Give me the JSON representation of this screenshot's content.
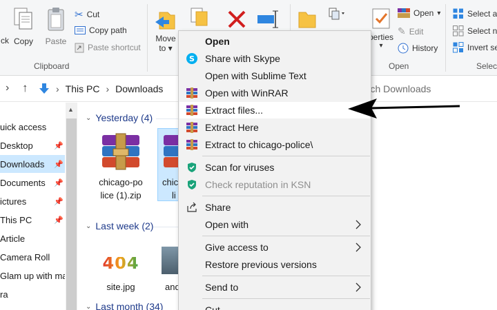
{
  "ribbon": {
    "clipboard": {
      "back_partial": "ck",
      "copy": "Copy",
      "paste": "Paste",
      "cut": "Cut",
      "copy_path": "Copy path",
      "paste_shortcut": "Paste shortcut",
      "group_label": "Clipboard"
    },
    "organize": {
      "move_to_line1": "Move",
      "move_to_line2": "to"
    },
    "open": {
      "properties_partial": "perties",
      "open": "Open",
      "edit": "Edit",
      "history": "History",
      "group_label": "Open"
    },
    "select": {
      "select_all": "Select al",
      "select_none": "Select no",
      "invert_selection": "Invert se",
      "group_label": "Selec"
    }
  },
  "address": {
    "this_pc": "This PC",
    "downloads": "Downloads",
    "search_placeholder": "arch Downloads"
  },
  "nav": {
    "items": [
      {
        "label": "uick access",
        "pinned": false,
        "selected": false
      },
      {
        "label": "Desktop",
        "pinned": true,
        "selected": false
      },
      {
        "label": "Downloads",
        "pinned": true,
        "selected": true
      },
      {
        "label": "Documents",
        "pinned": true,
        "selected": false
      },
      {
        "label": "ictures",
        "pinned": true,
        "selected": false
      },
      {
        "label": "This PC",
        "pinned": true,
        "selected": false
      },
      {
        "label": "Article",
        "pinned": false,
        "selected": false
      },
      {
        "label": "Camera Roll",
        "pinned": false,
        "selected": false
      },
      {
        "label": "Glam up with ma",
        "pinned": false,
        "selected": false
      },
      {
        "label": "ra",
        "pinned": false,
        "selected": false
      }
    ]
  },
  "files": {
    "groups": [
      {
        "label": "Yesterday (4)"
      },
      {
        "label": "Last week (2)"
      },
      {
        "label": "Last month (34)"
      }
    ],
    "items": [
      {
        "name_line1": "chicago-po",
        "name_line2": "lice (1).zip"
      },
      {
        "name_line1": "chic",
        "name_line2": "li"
      },
      {
        "name_line1": "site.jpg",
        "name_line2": ""
      },
      {
        "name_line1": "and",
        "name_line2": ""
      }
    ],
    "image_404_text": "404"
  },
  "context_menu": {
    "items": [
      {
        "label": "Open",
        "bold": true
      },
      {
        "label": "Share with Skype"
      },
      {
        "label": "Open with Sublime Text"
      },
      {
        "label": "Open with WinRAR"
      },
      {
        "label": "Extract files..."
      },
      {
        "label": "Extract Here"
      },
      {
        "label": "Extract to chicago-police\\"
      },
      {
        "label": "Scan for viruses"
      },
      {
        "label": "Check reputation in KSN"
      },
      {
        "label": "Share"
      },
      {
        "label": "Open with"
      },
      {
        "label": "Give access to"
      },
      {
        "label": "Restore previous versions"
      },
      {
        "label": "Send to"
      },
      {
        "label": "Cut"
      }
    ]
  },
  "colors": {
    "accent": "#0078d7",
    "selection": "#cce8ff",
    "menu_bg": "#f2f2f2",
    "kaspersky": "#1aa37a",
    "skype": "#00aff0",
    "delete_red": "#d11f1f",
    "folder_yellow": "#f6c243"
  },
  "icons": {
    "copy": "copy-icon",
    "paste": "paste-icon",
    "cut": "scissors-icon",
    "move_to": "move-to-icon",
    "delete": "delete-x-icon",
    "winrar": "winrar-icon",
    "skype": "skype-icon",
    "kaspersky": "kaspersky-shield-icon",
    "share": "share-icon",
    "arrow": "pointer-arrow"
  }
}
